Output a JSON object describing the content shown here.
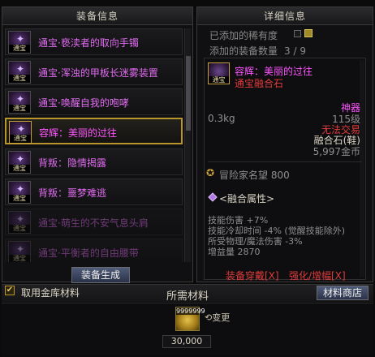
{
  "left_panel": {
    "title": "装备信息"
  },
  "equip_list": [
    {
      "name": "通宝·亵渎者的取向手镯",
      "tag": "通宝",
      "state": "normal"
    },
    {
      "name": "通宝·浑浊的甲板长迷雾装置",
      "tag": "通宝",
      "state": "normal"
    },
    {
      "name": "通宝·唤醒自我的咆哮",
      "tag": "通宝",
      "state": "normal"
    },
    {
      "name": "容辉：美丽的过往",
      "tag": "通宝",
      "state": "selected"
    },
    {
      "name": "背叛：隐情揭露",
      "tag": "通宝",
      "state": "normal"
    },
    {
      "name": "背叛：噩梦难逃",
      "tag": "通宝",
      "state": "normal"
    },
    {
      "name": "通宝·萌生的不安气息头肩",
      "tag": "通宝",
      "state": "dim"
    },
    {
      "name": "通宝·平衡者的自由腰带",
      "tag": "通宝",
      "state": "dim"
    }
  ],
  "generate_button": "装备生成",
  "right_panel": {
    "title": "详细信息",
    "added_rare_label": "已添加的稀有度",
    "added_count_label": "添加的装备数量",
    "added_count_value": "3 / 9"
  },
  "detail": {
    "tag": "通宝",
    "name": "容辉：美丽的过往",
    "type": "通宝融合石",
    "weight": "0.3kg",
    "grade": "神器",
    "level": "115级",
    "trade": "无法交易",
    "slot": "融合石(鞋)",
    "price": "5,997金币",
    "fame_label": "冒险家名望",
    "fame_value": "800",
    "fusion_title": "<融合属性>",
    "stats": [
      "技能伤害 +7%",
      "技能冷却时间 -4% (觉醒技能除外)",
      "所受物理/魔法伤害 -3%"
    ],
    "boost_label": "增益量",
    "boost_value": "2870",
    "link_equip": "装备穿戴[X]",
    "link_enhance": "强化/增幅[X]"
  },
  "materials": {
    "use_storage_label": "取用金库材料",
    "title": "所需材料",
    "shop_button": "材料商店",
    "gold_count": "9999999",
    "swap_label": "变更",
    "gold_amount": "30,000"
  },
  "colors": {
    "epic_pink": "#ff55ff",
    "item_magenta": "#e06bf0",
    "warning_red": "#e23b3b",
    "rare_gold": "#a08a28",
    "select_border": "#b8962c"
  }
}
